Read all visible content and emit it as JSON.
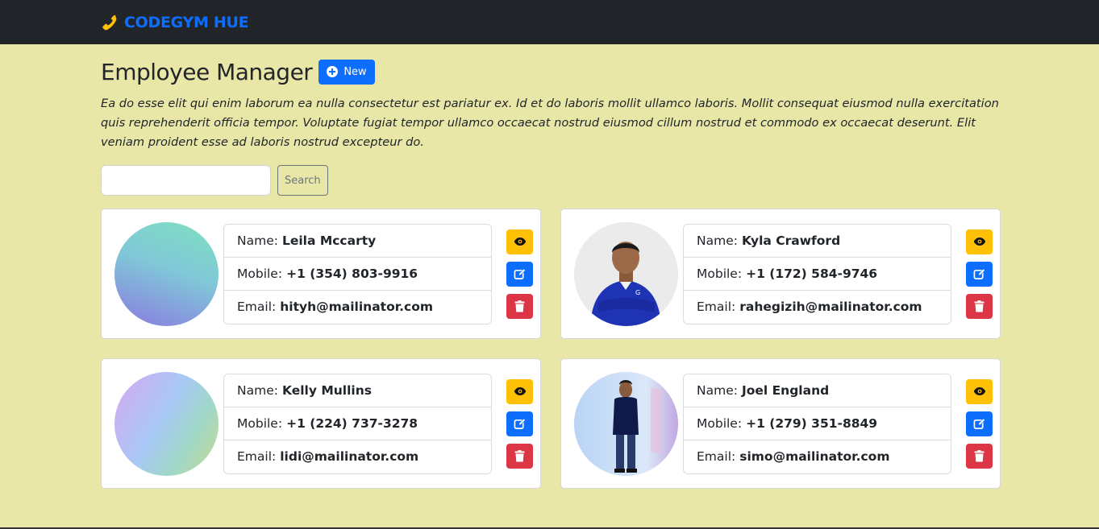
{
  "navbar": {
    "brand": "CODEGYM HUE",
    "brand_icon": "phone-icon",
    "brand_color": "#0d6efd",
    "icon_color": "#ffc107"
  },
  "header": {
    "title": "Employee Manager",
    "new_button_label": "New",
    "description": "Ea do esse elit qui enim laborum ea nulla consectetur est pariatur ex. Id et do laboris mollit ullamco laboris. Mollit consequat eiusmod nulla exercitation quis reprehenderit officia tempor. Voluptate fugiat tempor ullamco occaecat nostrud eiusmod cillum nostrud et commodo ex occaecat deserunt. Elit veniam proident esse ad laboris nostrud excepteur do."
  },
  "search": {
    "value": "",
    "placeholder": "",
    "button_label": "Search"
  },
  "labels": {
    "name": "Name:",
    "mobile": "Mobile:",
    "email": "Email:"
  },
  "employees": [
    {
      "name": "Leila Mccarty",
      "mobile": "+1 (354) 803-9916",
      "email": "hityh@mailinator.com",
      "avatar": "gradient-teal-purple"
    },
    {
      "name": "Kyla Crawford",
      "mobile": "+1 (172) 584-9746",
      "email": "rahegizih@mailinator.com",
      "avatar": "photo-man-blue-shirt"
    },
    {
      "name": "Kelly Mullins",
      "mobile": "+1 (224) 737-3278",
      "email": "lidi@mailinator.com",
      "avatar": "gradient-purple-green"
    },
    {
      "name": "Joel England",
      "mobile": "+1 (279) 351-8849",
      "email": "simo@mailinator.com",
      "avatar": "photo-man-standing"
    }
  ],
  "colors": {
    "background": "#e9e7a8",
    "view": "#ffc107",
    "edit": "#0d6efd",
    "delete": "#dc3545"
  }
}
